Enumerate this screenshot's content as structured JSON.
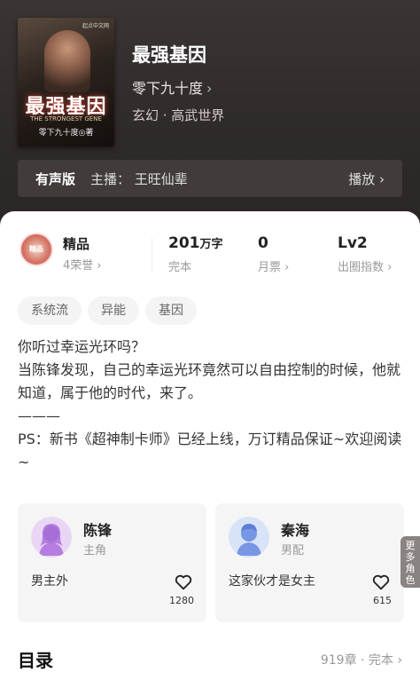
{
  "book": {
    "title": "最强基因",
    "author": "零下九十度",
    "genre": "玄幻 · 高武世界",
    "cover": {
      "title": "最强基因",
      "subtitle": "THE STRONGEST GENE",
      "author_line": "零下九十度◎著",
      "brand": "起点中文网"
    }
  },
  "audio": {
    "tag": "有声版",
    "host": "主播：  王旺仙辈",
    "play": "播放"
  },
  "badge": {
    "icon_text": "精品",
    "title": "精品",
    "sub": "4荣誉"
  },
  "stats": [
    {
      "value": "201",
      "unit": "万字",
      "label": "完本"
    },
    {
      "value": "0",
      "unit": "",
      "label": "月票"
    },
    {
      "value": "Lv2",
      "unit": "",
      "label": "出圈指数"
    }
  ],
  "tags": [
    "系统流",
    "异能",
    "基因"
  ],
  "description": [
    "你听过幸运光环吗？",
    "当陈锋发现，自己的幸运光环竟然可以自由控制的时候，他就知道，属于他的时代，来了。",
    "———",
    "PS：新书《超神制卡师》已经上线，万订精品保证~欢迎阅读~"
  ],
  "characters": [
    {
      "name": "陈锋",
      "role": "主角",
      "note": "男主外",
      "likes": "1280",
      "avatar_color": "#c893e6",
      "icon": "female-avatar-icon"
    },
    {
      "name": "秦海",
      "role": "男配",
      "note": "这家伙才是女主",
      "likes": "615",
      "avatar_color": "#7b9be6",
      "icon": "male-avatar-icon"
    }
  ],
  "more_characters": "更多角色",
  "toc": {
    "title": "目录",
    "meta": "919章 · 完本"
  },
  "colors": {
    "header_bg": "#2f2a2a",
    "sheet_bg": "#ffffff",
    "card_bg": "#f5f5f5"
  }
}
